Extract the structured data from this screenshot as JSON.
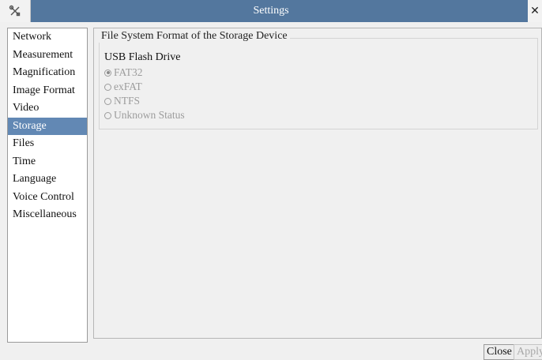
{
  "window": {
    "title": "Settings",
    "close_glyph": "✕",
    "app_icon": "tools-icon"
  },
  "sidebar": {
    "items": [
      {
        "label": "Network",
        "active": false
      },
      {
        "label": "Measurement",
        "active": false
      },
      {
        "label": "Magnification",
        "active": false
      },
      {
        "label": "Image Format",
        "active": false
      },
      {
        "label": "Video",
        "active": false
      },
      {
        "label": "Storage",
        "active": true
      },
      {
        "label": "Files",
        "active": false
      },
      {
        "label": "Time",
        "active": false
      },
      {
        "label": "Language",
        "active": false
      },
      {
        "label": "Voice Control",
        "active": false
      },
      {
        "label": "Miscellaneous",
        "active": false
      }
    ]
  },
  "storage": {
    "group_title": "File System Format of the Storage Device",
    "device_label": "USB Flash Drive",
    "options": [
      {
        "label": "FAT32",
        "checked": true
      },
      {
        "label": "exFAT",
        "checked": false
      },
      {
        "label": "NTFS",
        "checked": false
      },
      {
        "label": "Unknown Status",
        "checked": false
      }
    ]
  },
  "buttons": {
    "close": "Close",
    "apply": "Apply"
  },
  "colors": {
    "titlebar": "#53779e",
    "active_item": "#6288b4",
    "disabled_text": "#9c9c9c"
  }
}
